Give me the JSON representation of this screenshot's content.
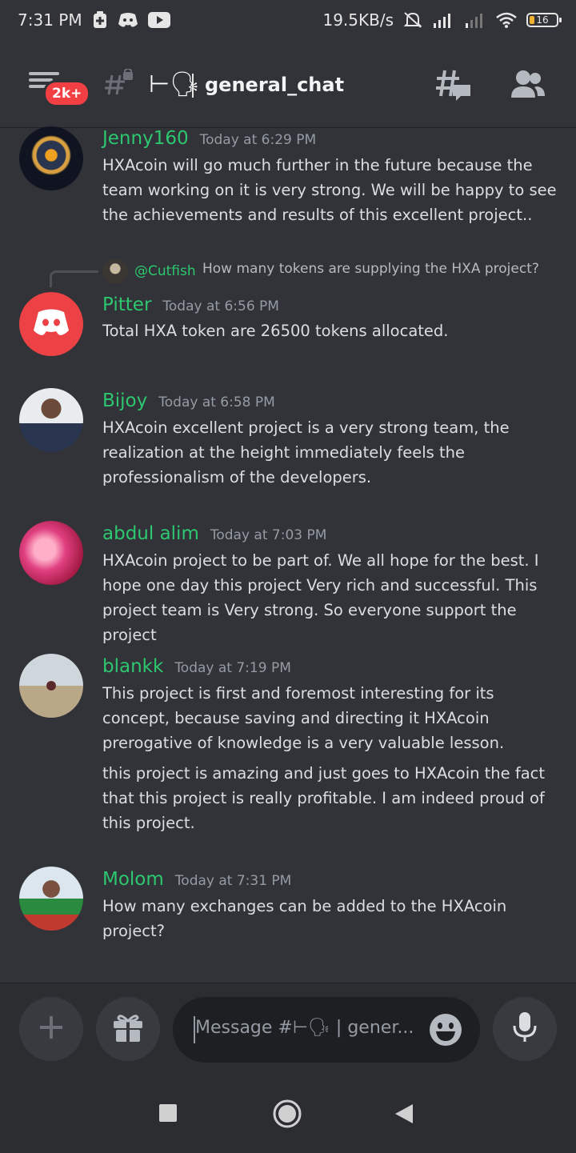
{
  "status_bar": {
    "time": "7:31 PM",
    "net_speed": "19.5KB/s",
    "battery": "16"
  },
  "header": {
    "unread_badge": "2k+",
    "channel_emoji": "⊢🗣",
    "channel_name": "general_chat"
  },
  "messages": [
    {
      "username": "Jenny160",
      "timestamp": "Today at 6:29 PM",
      "text": "HXAcoin will go much further in the future because the team working on it is very strong. We will be happy to see the achievements and results of this excellent project.."
    },
    {
      "reply_to_user": "@Cutfish",
      "reply_text": "How many tokens are supplying the HXA project?",
      "username": "Pitter",
      "timestamp": "Today at 6:56 PM",
      "text": "Total HXA token are 26500 tokens allocated."
    },
    {
      "username": "Bijoy",
      "timestamp": "Today at 6:58 PM",
      "text": "HXAcoin excellent project is a very strong team, the realization at the height immediately feels the professionalism of the developers."
    },
    {
      "username": "abdul alim",
      "timestamp": "Today at 7:03 PM",
      "text": "HXAcoin project to be part of. We all hope for the best. I hope one day this project Very rich and successful. This project team is Very strong. So everyone support the project"
    },
    {
      "username": "blankk",
      "timestamp": "Today at 7:19 PM",
      "text": "This project is first and foremost interesting for its concept, because saving and directing it HXAcoin prerogative of knowledge is a very valuable lesson.",
      "text2": "this project is amazing and just goes to HXAcoin the fact that this project is really profitable. I am indeed proud of this project."
    },
    {
      "username": "Molom",
      "timestamp": "Today at 7:31 PM",
      "text": "How many exchanges can be added to the HXAcoin project?"
    }
  ],
  "composer": {
    "placeholder": "Message #⊢🗣 | gener..."
  },
  "colors": {
    "background": "#313338",
    "username_green": "#2dc770",
    "badge_red": "#f23f43",
    "discord_red": "#ed4245"
  }
}
